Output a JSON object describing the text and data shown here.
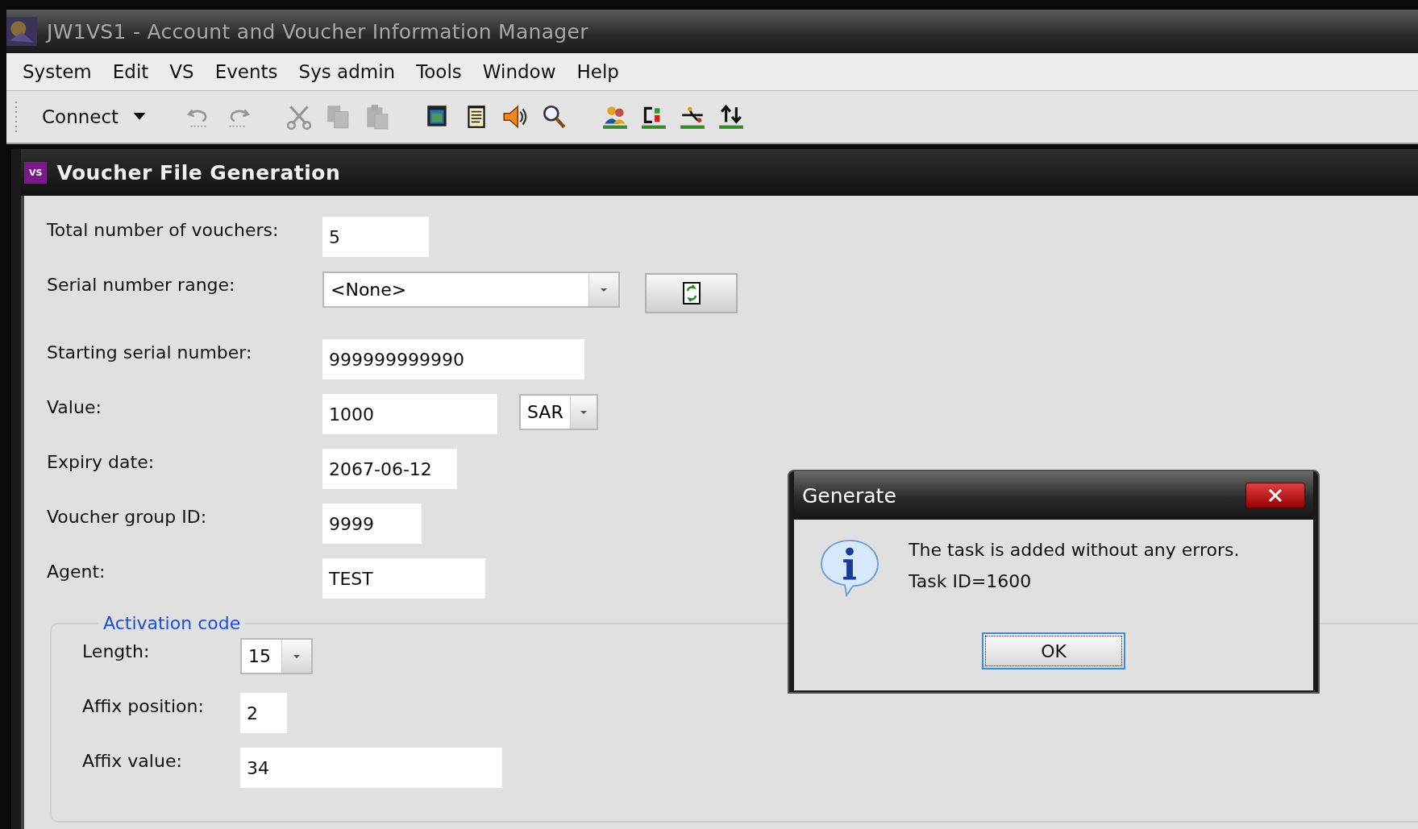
{
  "window": {
    "title": "JW1VS1 - Account and Voucher Information Manager"
  },
  "menu": [
    "System",
    "Edit",
    "VS",
    "Events",
    "Sys admin",
    "Tools",
    "Window",
    "Help"
  ],
  "toolbar": {
    "connect": "Connect",
    "buttons": [
      {
        "kind": "undo",
        "disabled": true
      },
      {
        "kind": "redo",
        "disabled": true
      },
      {
        "kind": "cut",
        "disabled": true
      },
      {
        "kind": "copy",
        "disabled": true
      },
      {
        "kind": "paste",
        "disabled": true
      },
      {
        "kind": "window",
        "disabled": false
      },
      {
        "kind": "document",
        "disabled": false
      },
      {
        "kind": "speaker",
        "disabled": false
      },
      {
        "kind": "search",
        "disabled": false
      },
      {
        "kind": "users",
        "disabled": false
      },
      {
        "kind": "card",
        "disabled": false
      },
      {
        "kind": "route",
        "disabled": false
      },
      {
        "kind": "sort",
        "disabled": false
      }
    ]
  },
  "child_window": {
    "badge": "VS",
    "title": "Voucher File Generation"
  },
  "form": [
    {
      "kind": "text",
      "label": "Total number of vouchers:",
      "value": "5"
    },
    {
      "kind": "combo_button",
      "label": "Serial number range:",
      "value": "<None>"
    },
    {
      "kind": "text",
      "label": "Starting serial number:",
      "value": "999999999990"
    },
    {
      "kind": "text_combo",
      "label": "Value:",
      "value": "1000",
      "currency": "SAR"
    },
    {
      "kind": "text",
      "label": "Expiry date:",
      "value": "2067-06-12"
    },
    {
      "kind": "text",
      "label": "Voucher group ID:",
      "value": "9999"
    },
    {
      "kind": "text",
      "label": "Agent:",
      "value": "TEST"
    }
  ],
  "activation_code": {
    "title": "Activation code",
    "fields": [
      {
        "kind": "combo",
        "label": "Length:",
        "value": "15"
      },
      {
        "kind": "text",
        "label": "Affix position:",
        "value": "2"
      },
      {
        "kind": "text",
        "label": "Affix value:",
        "value": "34"
      }
    ]
  },
  "dialog": {
    "title": "Generate",
    "message": [
      "The task is added without any errors.",
      "Task ID=1600"
    ],
    "button": "OK"
  }
}
